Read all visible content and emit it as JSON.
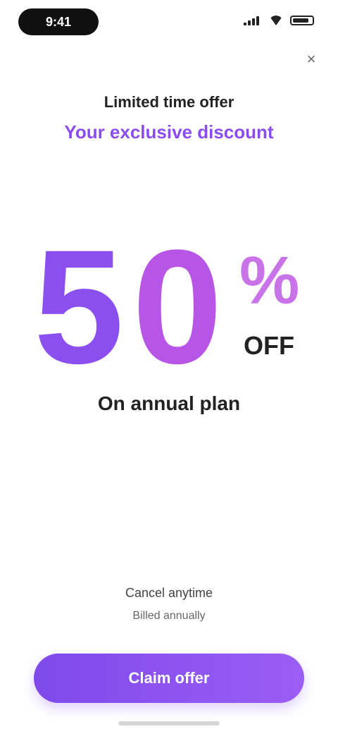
{
  "status_bar": {
    "time": "9:41",
    "icons": [
      "signal-icon",
      "wifi-icon",
      "battery-icon"
    ]
  },
  "close": {
    "label": "×"
  },
  "offer": {
    "kicker": "Limited time offer",
    "headline": "Your exclusive discount",
    "digit_one": "5",
    "digit_two": "0",
    "percent": "%",
    "off": "OFF",
    "subline": "On annual plan"
  },
  "footer": {
    "fine_print_1": "Cancel anytime",
    "fine_print_2": "Billed annually"
  },
  "cta": {
    "label": "Claim offer"
  },
  "colors": {
    "accent": "#8b4ff0",
    "accent_secondary": "#b655e6",
    "text": "#222222"
  }
}
